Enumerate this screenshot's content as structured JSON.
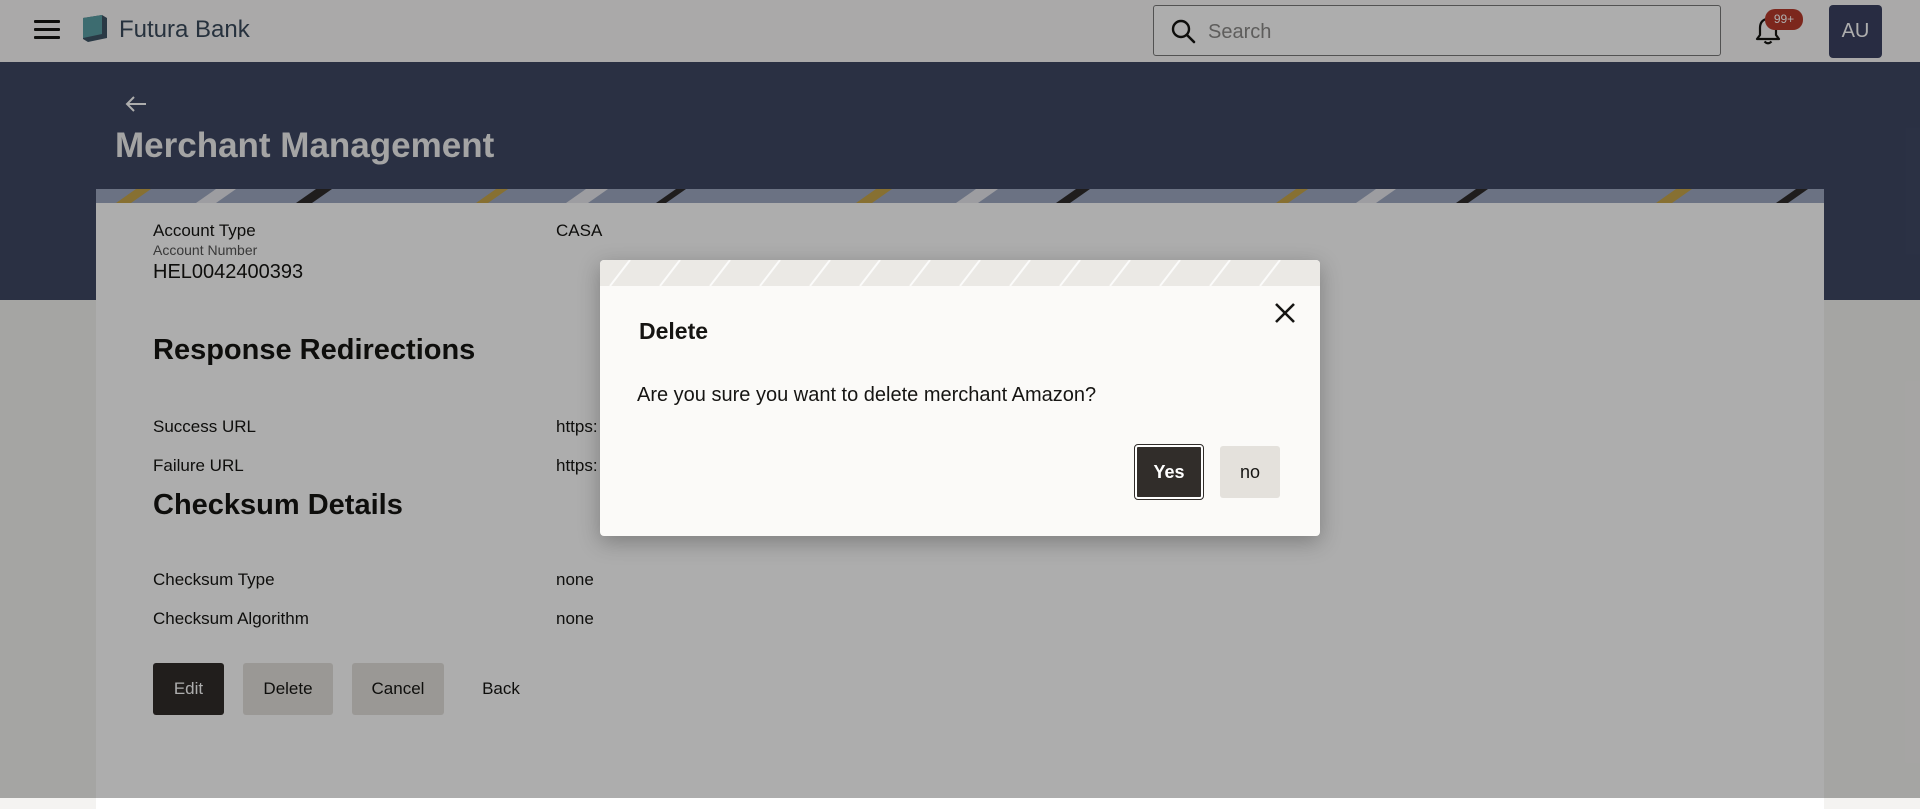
{
  "header": {
    "brand": "Futura Bank",
    "search_placeholder": "Search",
    "notification_count": "99+",
    "avatar_initials": "AU"
  },
  "page": {
    "title": "Merchant Management"
  },
  "account": {
    "type_label": "Account Type",
    "type_value": "CASA",
    "number_label": "Account Number",
    "number_value": "HEL0042400393"
  },
  "redirections": {
    "title": "Response Redirections",
    "success_label": "Success URL",
    "success_value": "https:",
    "failure_label": "Failure URL",
    "failure_value": "https:"
  },
  "checksum": {
    "title": "Checksum Details",
    "type_label": "Checksum Type",
    "type_value": "none",
    "algorithm_label": "Checksum Algorithm",
    "algorithm_value": "none"
  },
  "actions": {
    "edit": "Edit",
    "delete": "Delete",
    "cancel": "Cancel",
    "back": "Back"
  },
  "dialog": {
    "title": "Delete",
    "message": "Are you sure you want to delete merchant Amazon?",
    "yes": "Yes",
    "no": "no"
  },
  "colors": {
    "header_bg": "#fbfaf9",
    "hero_bg": "#3f4864",
    "primary_button": "#312d2a",
    "secondary_button": "#e4e1dc",
    "badge": "#b73a2c",
    "avatar_bg": "#3b4262"
  },
  "icons": [
    "hamburger-icon",
    "bank-logo-icon",
    "search-icon",
    "bell-icon",
    "back-arrow-icon",
    "close-icon"
  ]
}
